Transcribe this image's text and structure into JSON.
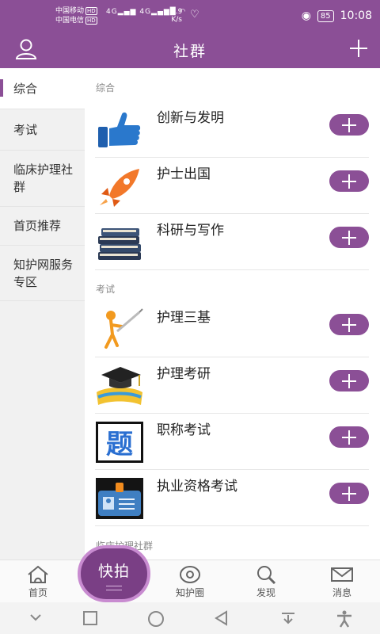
{
  "status_bar": {
    "carrier1": "中国移动",
    "carrier2": "中国电信",
    "hd": "HD",
    "signal1": "4G",
    "signal2": "4G",
    "speed_value": "4.9",
    "speed_unit": "K/s",
    "battery": "85",
    "time": "10:08"
  },
  "header": {
    "title": "社群",
    "left_icon": "user-icon",
    "right_icon": "plus-icon"
  },
  "sidebar": {
    "items": [
      {
        "label": "综合",
        "active": true
      },
      {
        "label": "考试",
        "active": false
      },
      {
        "label": "临床护理社群",
        "active": false
      },
      {
        "label": "首页推荐",
        "active": false
      },
      {
        "label": "知护网服务专区",
        "active": false
      }
    ]
  },
  "main": {
    "sections": [
      {
        "title": "综合",
        "items": [
          {
            "name": "创新与发明",
            "icon": "thumbs-up-icon"
          },
          {
            "name": "护士出国",
            "icon": "rocket-icon"
          },
          {
            "name": "科研与写作",
            "icon": "books-icon"
          }
        ]
      },
      {
        "title": "考试",
        "items": [
          {
            "name": "护理三基",
            "icon": "figure-pen-icon"
          },
          {
            "name": "护理考研",
            "icon": "graduation-cap-icon"
          },
          {
            "name": "职称考试",
            "icon": "question-ti-icon"
          },
          {
            "name": "执业资格考试",
            "icon": "id-badge-icon"
          }
        ]
      },
      {
        "title": "临床护理社群",
        "items": []
      }
    ],
    "ti_glyph": "题"
  },
  "tabbar": {
    "items": [
      {
        "label": "首页",
        "icon": "home-icon"
      },
      {
        "label": "知护圈",
        "icon": "eye-circle-icon"
      },
      {
        "label": "发现",
        "icon": "search-icon"
      },
      {
        "label": "消息",
        "icon": "mail-icon"
      }
    ],
    "fab_label": "快拍"
  },
  "colors": {
    "brand": "#8b4f96",
    "sidebar_bg": "#f1f1f1"
  }
}
